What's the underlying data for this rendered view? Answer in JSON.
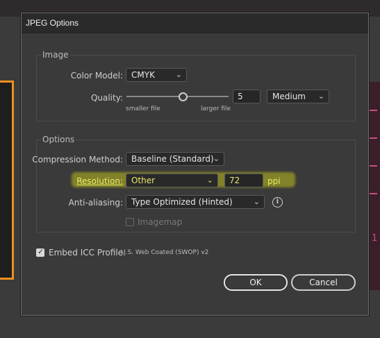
{
  "dialog": {
    "title": "JPEG Options"
  },
  "image_group": {
    "label": "Image",
    "color_model": {
      "label": "Color Model:",
      "value": "CMYK"
    },
    "quality": {
      "label": "Quality:",
      "level": 0.55,
      "value": "5",
      "preset": "Medium",
      "min_label": "smaller file",
      "max_label": "larger file"
    }
  },
  "options_group": {
    "label": "Options",
    "compression": {
      "label": "Compression Method:",
      "value": "Baseline (Standard)"
    },
    "resolution": {
      "label": "Resolution:",
      "value": "Other",
      "ppi": "72",
      "unit": "ppi"
    },
    "anti_aliasing": {
      "label": "Anti-aliasing:",
      "value": "Type Optimized (Hinted)"
    },
    "imagemap": {
      "label": "Imagemap",
      "checked": false
    }
  },
  "embed_icc": {
    "label": "Embed ICC Profile:",
    "profile": "U.S. Web Coated (SWOP) v2",
    "checked": true
  },
  "buttons": {
    "ok": "OK",
    "cancel": "Cancel"
  },
  "icons": {
    "chevron": "chevron-down-icon",
    "info": "info-icon",
    "check": "checkmark-icon"
  },
  "background": {
    "right_panel_text": "1"
  }
}
